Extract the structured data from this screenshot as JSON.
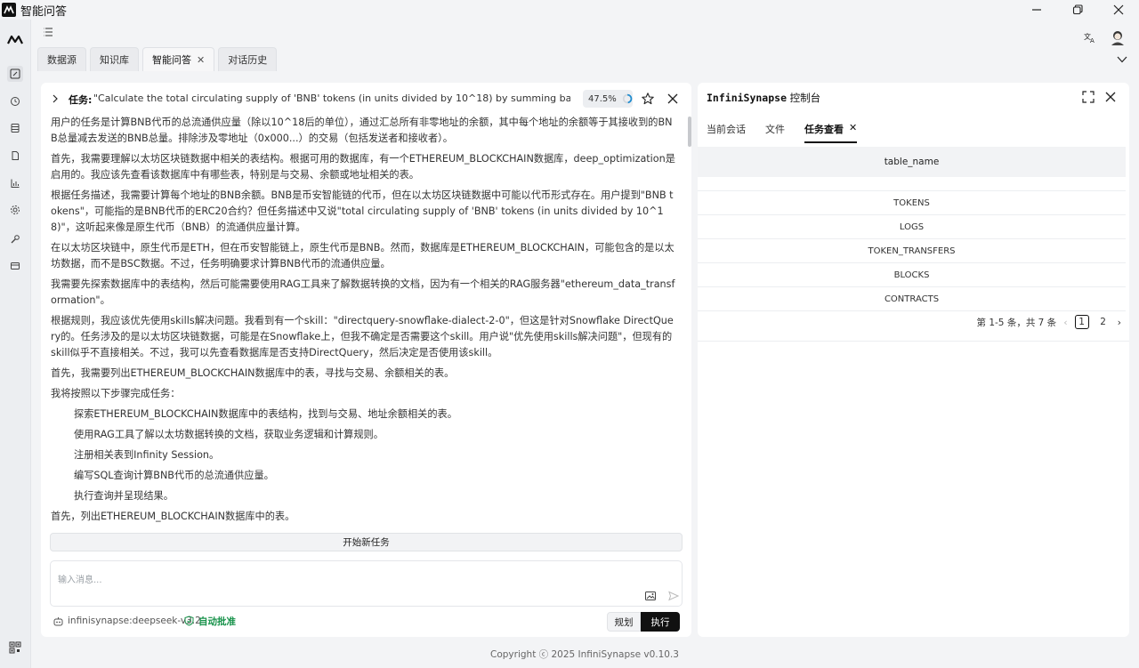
{
  "window": {
    "title": "智能问答"
  },
  "tabs": [
    {
      "label": "数据源"
    },
    {
      "label": "知识库"
    },
    {
      "label": "智能问答"
    },
    {
      "label": "对话历史"
    }
  ],
  "task": {
    "label": "任务:",
    "text": "\"Calculate the total circulating supply of 'BNB' tokens (in units divided by 10^18) by summing balances of all non-zero addr...",
    "progress": "47.5%",
    "progress_value": 0.475
  },
  "content": {
    "paragraphs": [
      "用户的任务是计算BNB代币的总流通供应量（除以10^18后的单位），通过汇总所有非零地址的余额，其中每个地址的余额等于其接收到的BNB总量减去发送的BNB总量。排除涉及零地址（0x000...）的交易（包括发送者和接收者）。",
      "首先，我需要理解以太坊区块链数据中相关的表结构。根据可用的数据库，有一个ETHEREUM_BLOCKCHAIN数据库，deep_optimization是启用的。我应该先查看该数据库中有哪些表，特别是与交易、余额或地址相关的表。",
      "根据任务描述，我需要计算每个地址的BNB余额。BNB是币安智能链的代币，但在以太坊区块链数据中可能以代币形式存在。用户提到\"BNB tokens\"，可能指的是BNB代币的ERC20合约？但任务描述中又说\"total circulating supply of 'BNB' tokens (in units divided by 10^18)\"，这听起来像是原生代币（BNB）的流通供应量计算。",
      "在以太坊区块链中，原生代币是ETH，但在币安智能链上，原生代币是BNB。然而，数据库是ETHEREUM_BLOCKCHAIN，可能包含的是以太坊数据，而不是BSC数据。不过，任务明确要求计算BNB代币的流通供应量。",
      "我需要先探索数据库中的表结构，然后可能需要使用RAG工具来了解数据转换的文档，因为有一个相关的RAG服务器\"ethereum_data_transformation\"。",
      "根据规则，我应该优先使用skills解决问题。我看到有一个skill：\"directquery-snowflake-dialect-2-0\"，但这是针对Snowflake DirectQuery的。任务涉及的是以太坊区块链数据，可能是在Snowflake上，但我不确定是否需要这个skill。用户说\"优先使用skills解决问题\"，但现有的skill似乎不直接相关。不过，我可以先查看数据库是否支持DirectQuery，然后决定是否使用该skill。",
      "首先，我需要列出ETHEREUM_BLOCKCHAIN数据库中的表，寻找与交易、余额相关的表。",
      "我将按照以下步骤完成任务："
    ],
    "steps": [
      "探索ETHEREUM_BLOCKCHAIN数据库中的表结构，找到与交易、地址余额相关的表。",
      "使用RAG工具了解以太坊数据转换的文档，获取业务逻辑和计算规则。",
      "注册相关表到Infinity Session。",
      "编写SQL查询计算BNB代币的总流通供应量。",
      "执行查询并呈现结果。"
    ],
    "trailing": "首先，列出ETHEREUM_BLOCKCHAIN数据库中的表。"
  },
  "composer": {
    "new_task_label": "开始新任务",
    "placeholder": "输入消息...",
    "model": "infinisynapse:deepseek-v3.2",
    "auto_approve": "自动批准",
    "plan_label": "规划",
    "execute_label": "执行"
  },
  "console": {
    "title_mono": "InfiniSynapse",
    "title_suffix": "控制台",
    "tabs": [
      {
        "label": "当前会话"
      },
      {
        "label": "文件"
      },
      {
        "label": "任务查看"
      }
    ],
    "table": {
      "header": "table_name",
      "rows": [
        "TOKENS",
        "LOGS",
        "TOKEN_TRANSFERS",
        "BLOCKS",
        "CONTRACTS"
      ]
    },
    "pagination": {
      "summary": "第 1-5 条，共 7 条",
      "pages": [
        "1",
        "2"
      ],
      "current": "1"
    }
  },
  "footer": {
    "copyright": "Copyright ⓒ 2025 InfiniSynapse v0.10.3"
  },
  "colors": {
    "accent": "#111111",
    "approve": "#17924a",
    "progress_ring": "#1f8ccf"
  }
}
